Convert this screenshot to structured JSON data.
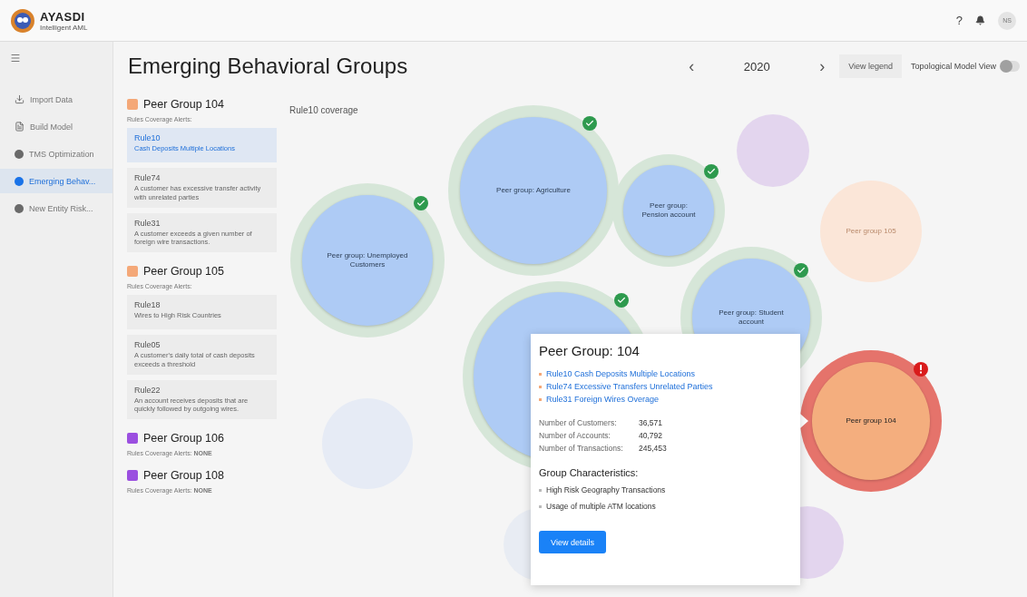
{
  "app": {
    "brand": "AYASDI",
    "subtitle": "Intelligent AML",
    "help": "?",
    "avatar": "NS"
  },
  "sidebar": {
    "items": [
      {
        "label": "Import Data",
        "kind": "download",
        "selected": false
      },
      {
        "label": "Build Model",
        "kind": "file",
        "selected": false
      },
      {
        "label": "TMS Optimization",
        "kind": "dot",
        "selected": false
      },
      {
        "label": "Emerging Behav...",
        "kind": "dot",
        "selected": true
      },
      {
        "label": "New Entity Risk...",
        "kind": "dot",
        "selected": false
      }
    ]
  },
  "page": {
    "title": "Emerging Behavioral Groups",
    "prev": "‹",
    "year": "2020",
    "next": "›",
    "legend_button": "View legend",
    "toggle": {
      "label": "Topological Model View",
      "on": false
    }
  },
  "groups": [
    {
      "name": "Peer Group 104",
      "color": "#f4a878",
      "alerts_label": "Rules Coverage Alerts:",
      "rules": [
        {
          "id": "Rule10",
          "description": "Cash Deposits Multiple Locations",
          "selected": true
        },
        {
          "id": "Rule74",
          "description": "A customer has excessive transfer activity with unrelated parties",
          "selected": false
        },
        {
          "id": "Rule31",
          "description": "A customer exceeds a given number of foreign wire transactions.",
          "selected": false
        }
      ]
    },
    {
      "name": "Peer Group 105",
      "color": "#f4a878",
      "alerts_label": "Rules Coverage Alerts:",
      "rules": [
        {
          "id": "Rule18",
          "description": "Wires to High Risk Countries",
          "selected": false
        },
        {
          "id": "Rule05",
          "description": "A customer's daily total of cash deposits exceeds a threshold",
          "selected": false
        },
        {
          "id": "Rule22",
          "description": "An account receives deposits that are quickly followed by outgoing wires.",
          "selected": false
        }
      ]
    },
    {
      "name": "Peer Group 106",
      "color": "#9b4fe0",
      "alerts_label": "Rules Coverage Alerts: **NONE**"
    },
    {
      "name": "Peer Group 108",
      "color": "#9b4fe0",
      "alerts_label": "Rules Coverage Alerts: **NONE**"
    }
  ],
  "canvas": {
    "caption": "Rule10 coverage",
    "bubbles": [
      {
        "kind": "faded",
        "color": "#e3d5ee"
      },
      {
        "kind": "faded",
        "color": "#fbe6d8",
        "label": "Peer group 105"
      },
      {
        "kind": "faded",
        "color": "#e6ebf5"
      },
      {
        "kind": "faded",
        "color": "#e3d5ee"
      },
      {
        "kind": "faded",
        "color": "#e8ecf3"
      },
      {
        "kind": "covered",
        "label": "Peer group: Unemployed Customers"
      },
      {
        "kind": "covered",
        "label": "Peer group: Agriculture"
      },
      {
        "kind": "covered",
        "label": "Peer group: Pension account"
      },
      {
        "kind": "covered"
      },
      {
        "kind": "covered",
        "label": "Peer group: Student account"
      },
      {
        "kind": "alert",
        "label": "Peer group 104"
      }
    ],
    "popup": {
      "title": "Peer Group: 104",
      "links": [
        "Rule10 Cash Deposits Multiple Locations",
        "Rule74 Excessive Transfers Unrelated Parties",
        "Rule31 Foreign Wires Overage"
      ],
      "stats": [
        {
          "label": "Number of Customers:",
          "value": "36,571"
        },
        {
          "label": "Number of Accounts:",
          "value": "40,792"
        },
        {
          "label": "Number of Transactions:",
          "value": "245,453"
        }
      ],
      "characteristics_title": "Group Characteristics:",
      "characteristics": [
        "High Risk Geography Transactions",
        "Usage of multiple ATM locations"
      ],
      "button": "View details"
    }
  }
}
